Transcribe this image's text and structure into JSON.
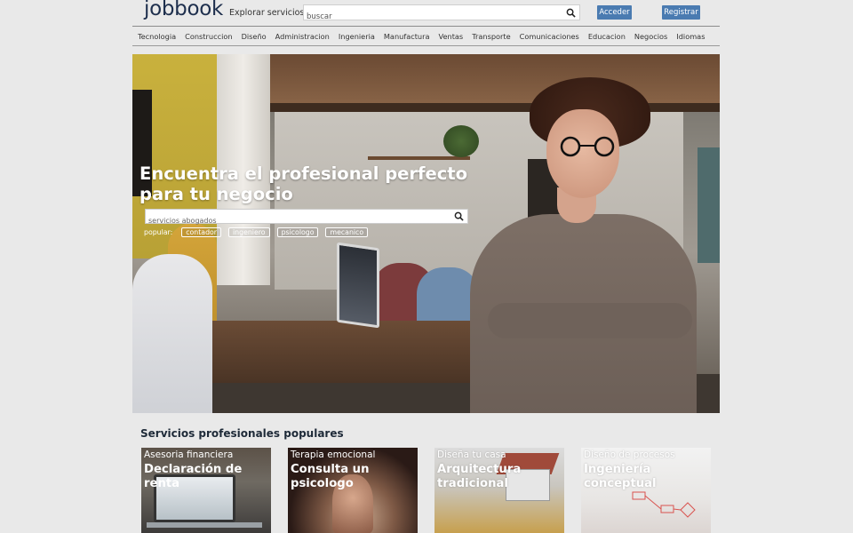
{
  "header": {
    "logo": "jobbook",
    "explore_label": "Explorar servicios",
    "search_placeholder": "buscar",
    "login_label": "Acceder",
    "register_label": "Registrar"
  },
  "nav": {
    "items": [
      "Tecnologia",
      "Construccion",
      "Diseño",
      "Administracion",
      "Ingenieria",
      "Manufactura",
      "Ventas",
      "Transporte",
      "Comunicaciones",
      "Educacion",
      "Negocios",
      "Idiomas"
    ]
  },
  "hero": {
    "title": "Encuentra el profesional perfecto para tu negocio",
    "search_placeholder": "servicios abogados",
    "popular_label": "popular:",
    "tags": [
      "contador",
      "ingeniero",
      "psicologo",
      "mecanico"
    ]
  },
  "services": {
    "title": "Servicios profesionales populares",
    "cards": [
      {
        "category": "Asesoria financiera",
        "title": "Declaración de renta"
      },
      {
        "category": "Terapia emocional",
        "title": "Consulta un psicologo"
      },
      {
        "category": "Diseña tu casa",
        "title": "Arquitectura tradicional"
      },
      {
        "category": "Diseño de procesos",
        "title": "Ingeniería conceptual"
      }
    ]
  },
  "colors": {
    "accent": "#4a7bb1",
    "logo": "#1e2f4d",
    "page_bg": "#e9e9e9"
  },
  "icons": {
    "search": "search-icon"
  }
}
